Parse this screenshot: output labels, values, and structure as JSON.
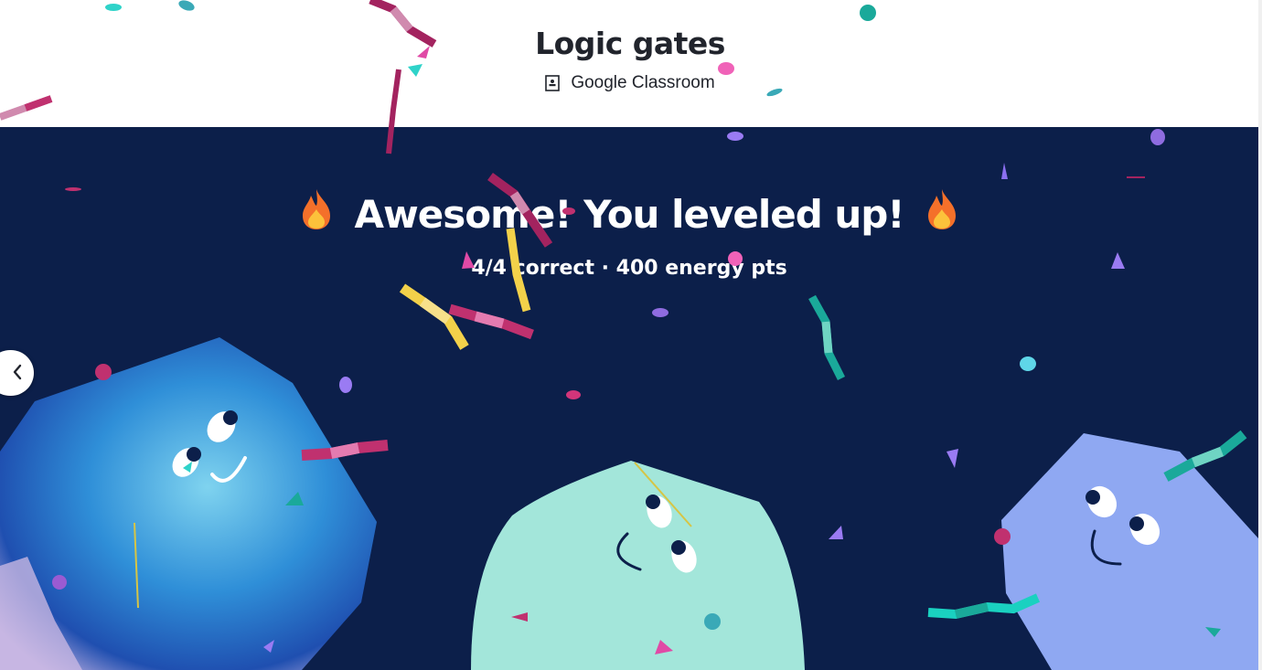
{
  "header": {
    "title": "Logic gates",
    "classroom_label": "Google Classroom",
    "classroom_icon": "google-classroom-icon"
  },
  "celebration": {
    "headline": "Awesome! You leveled up!",
    "headline_icon": "fire-emoji-icon",
    "stats": "4/4 correct · 400 energy pts"
  },
  "navigation": {
    "prev_icon": "chevron-left-icon"
  },
  "colors": {
    "stage_background": "#0c1f4a",
    "title_text": "#21242c",
    "creature_blue": "#2f6fd6",
    "creature_mint": "#a3e6da",
    "creature_periwinkle": "#8fa8f2"
  }
}
